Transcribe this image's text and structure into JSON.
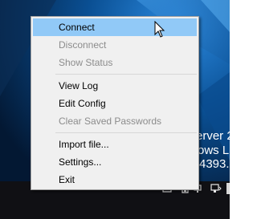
{
  "desktop": {
    "watermark_lines": [
      "erver 2",
      "ows L",
      "4393."
    ]
  },
  "menu": {
    "items": [
      {
        "label": "Connect",
        "enabled": true,
        "highlighted": true
      },
      {
        "label": "Disconnect",
        "enabled": false
      },
      {
        "label": "Show Status",
        "enabled": false
      },
      {
        "label": "View Log",
        "enabled": true
      },
      {
        "label": "Edit Config",
        "enabled": true
      },
      {
        "label": "Clear Saved Passwords",
        "enabled": false
      },
      {
        "label": "Import file...",
        "enabled": true
      },
      {
        "label": "Settings...",
        "enabled": true
      },
      {
        "label": "Exit",
        "enabled": true
      }
    ]
  },
  "tray": {
    "icons": [
      "up-arrow-icon",
      "action-center-icon",
      "battery-icon",
      "network-icon",
      "volume-icon"
    ]
  },
  "colors": {
    "menu_bg": "#f0f0f0",
    "highlight": "#91c9f7",
    "disabled_text": "#8c8c8c",
    "wallpaper_blue": "#0a5ea8"
  }
}
